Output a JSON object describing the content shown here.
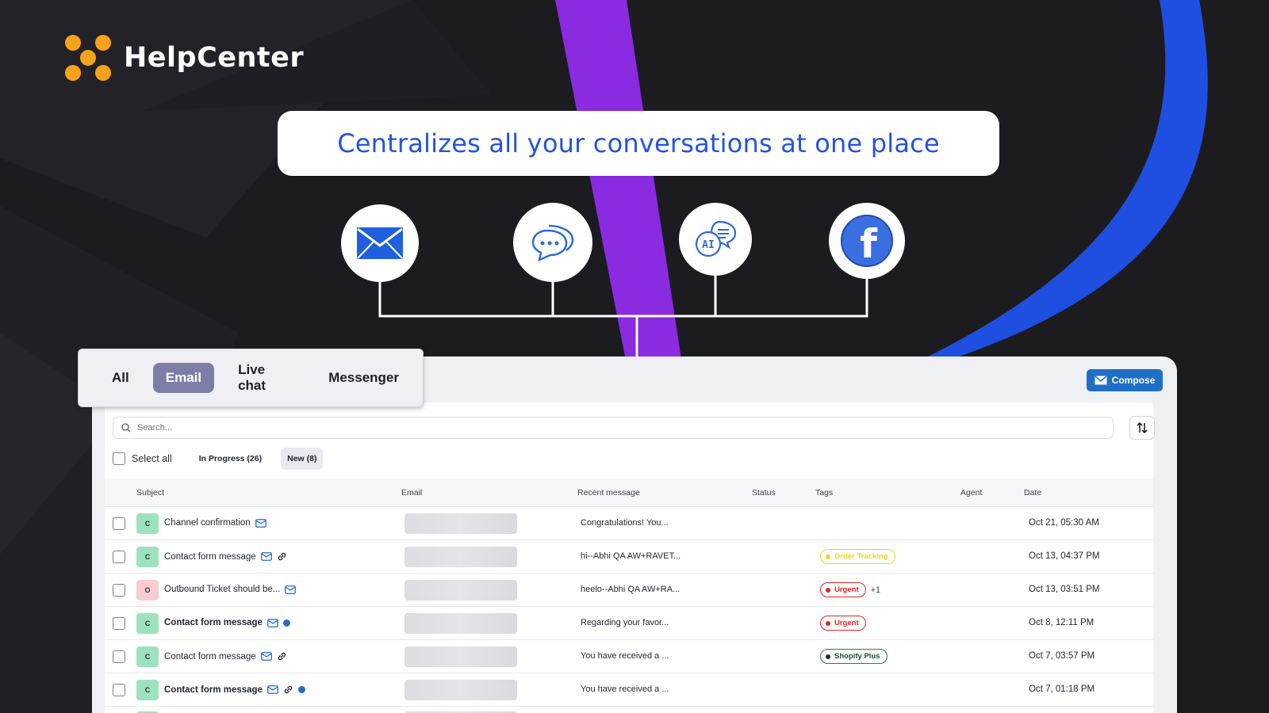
{
  "brand": {
    "name": "HelpCenter"
  },
  "headline": "Centralizes all your conversations at one place",
  "channels": [
    {
      "icon": "email-envelope-icon"
    },
    {
      "icon": "chat-bubbles-icon"
    },
    {
      "icon": "ai-chat-icon",
      "label": "AI"
    },
    {
      "icon": "facebook-icon",
      "label": "f"
    }
  ],
  "tabs": [
    {
      "label": "All",
      "active": false
    },
    {
      "label": "Email",
      "active": true
    },
    {
      "label": "Live chat",
      "active": false
    },
    {
      "label": "Messenger",
      "active": false
    }
  ],
  "toolbar": {
    "compose_label": "Compose"
  },
  "search": {
    "placeholder": "Search..."
  },
  "filters": {
    "select_all": "Select all",
    "in_progress": "In Progress (26)",
    "new": "New (8)"
  },
  "columns": {
    "subject": "Subject",
    "email": "Email",
    "recent": "Recent message",
    "status": "Status",
    "tags": "Tags",
    "agent": "Agent",
    "date": "Date"
  },
  "rows": [
    {
      "avatar": "C",
      "subject": "Channel confirmation",
      "message": "Congratulations! You...",
      "date": "Oct 21, 05:30 AM",
      "tags": [],
      "more": ""
    },
    {
      "avatar": "C",
      "subject": "Contact form message",
      "message": "hi--Abhi QA AW+RAVET...",
      "date": "Oct 13, 04:37 PM",
      "tags": [
        "Order Tracking"
      ],
      "more": ""
    },
    {
      "avatar": "O",
      "subject": "Outbound Ticket should be...",
      "message": "heelo--Abhi QA AW+RA...",
      "date": "Oct 13, 03:51 PM",
      "tags": [
        "Urgent"
      ],
      "more": "+1"
    },
    {
      "avatar": "C",
      "subject": "Contact form message",
      "message": "Regarding your favor...",
      "date": "Oct 8, 12:11 PM",
      "tags": [
        "Urgent"
      ],
      "more": ""
    },
    {
      "avatar": "C",
      "subject": "Contact form message",
      "message": "You have received a ...",
      "date": "Oct 7, 03:57 PM",
      "tags": [
        "Shopify Plus"
      ],
      "more": ""
    },
    {
      "avatar": "C",
      "subject": "Contact form message",
      "message": "You have received a ...",
      "date": "Oct 7, 01:18 PM",
      "tags": [],
      "more": ""
    }
  ],
  "colors": {
    "brand_orange": "#f7a21b",
    "headline_blue": "#2453e0",
    "accent_purple": "#8a2be2",
    "accent_blue": "#1f4fe0",
    "compose_blue": "#1f6fc7",
    "active_tab": "#7d7ea8"
  }
}
